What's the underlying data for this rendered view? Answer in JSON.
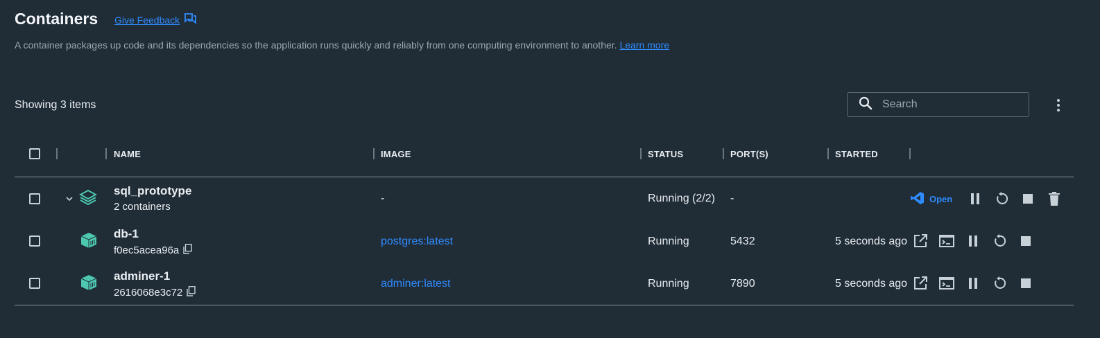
{
  "page": {
    "title": "Containers",
    "feedback_label": "Give Feedback",
    "description": "A container packages up code and its dependencies so the application runs quickly and reliably from one computing environment to another.",
    "learn_more_label": "Learn more"
  },
  "toolbar": {
    "showing_label": "Showing 3 items",
    "search_placeholder": "Search"
  },
  "table": {
    "headers": {
      "name": "NAME",
      "image": "IMAGE",
      "status": "STATUS",
      "ports": "PORT(S)",
      "started": "STARTED"
    },
    "group": {
      "name": "sql_prototype",
      "sub": "2 containers",
      "image": "-",
      "status": "Running (2/2)",
      "ports": "-",
      "open_label": "Open"
    },
    "rows": [
      {
        "name": "db-1",
        "id": "f0ec5acea96a",
        "image": "postgres:latest",
        "status": "Running",
        "ports": "5432",
        "started": "5 seconds ago"
      },
      {
        "name": "adminer-1",
        "id": "2616068e3c72",
        "image": "adminer:latest",
        "status": "Running",
        "ports": "7890",
        "started": "5 seconds ago"
      }
    ]
  },
  "colors": {
    "background": "#202c36",
    "accent": "#2f8cff",
    "container_icon": "#4dc7b0",
    "icon": "#c9d1d8"
  },
  "icons": {
    "feedback": "chat-icon",
    "search": "search-icon",
    "menu": "kebab-icon",
    "group": "stack-icon",
    "container": "cube-icon",
    "copy": "copy-icon",
    "vscode": "vscode-icon",
    "open_browser": "external-link-icon",
    "terminal": "terminal-icon",
    "pause": "pause-icon",
    "restart": "restart-icon",
    "stop": "stop-icon",
    "delete": "trash-icon"
  }
}
